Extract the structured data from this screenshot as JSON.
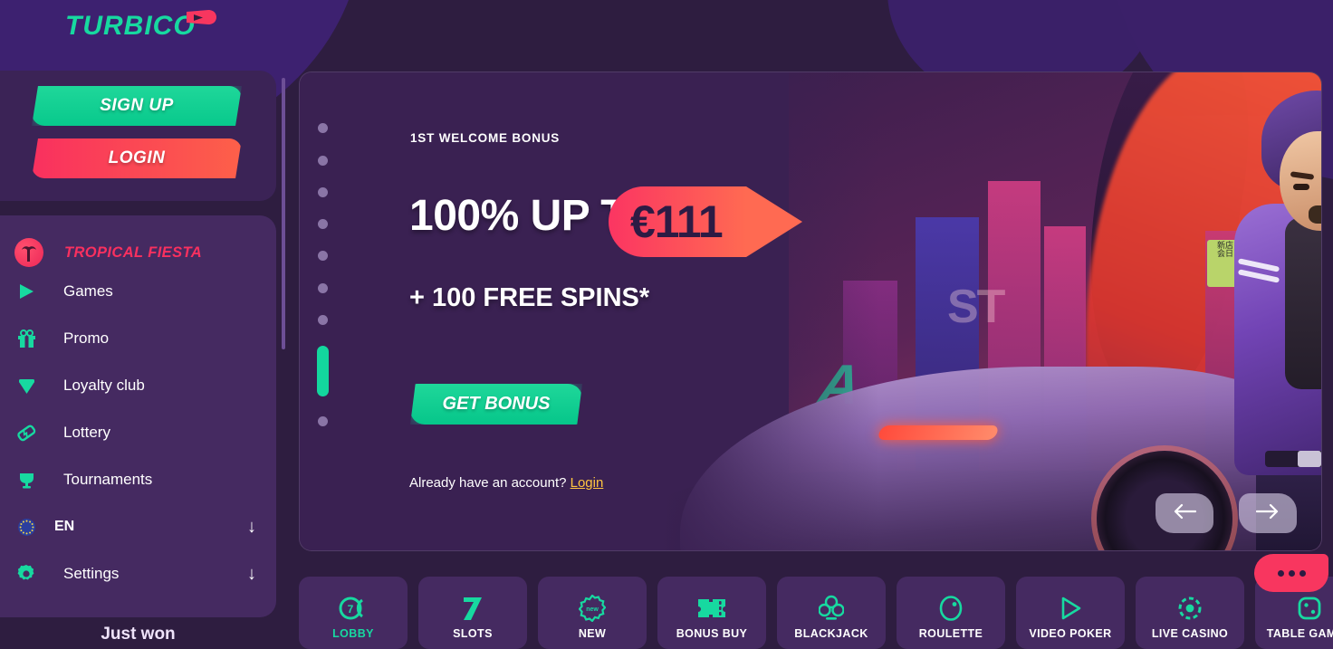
{
  "brand": {
    "name": "TURBICO",
    "logo_icon": "turbico-rocket-icon"
  },
  "auth": {
    "signup_label": "SIGN UP",
    "login_label": "LOGIN"
  },
  "sidebar": {
    "promo": {
      "label": "TROPICAL FIESTA",
      "icon": "palm-tree-circle-icon"
    },
    "items": [
      {
        "label": "Games",
        "icon": "play-triangle-icon"
      },
      {
        "label": "Promo",
        "icon": "gift-icon"
      },
      {
        "label": "Loyalty club",
        "icon": "diamond-icon"
      },
      {
        "label": "Lottery",
        "icon": "ticket-icon"
      },
      {
        "label": "Tournaments",
        "icon": "trophy-icon"
      }
    ],
    "language": {
      "label": "EN",
      "icon": "eu-flag-icon",
      "arrow": "↓"
    },
    "settings": {
      "label": "Settings",
      "icon": "gear-icon",
      "arrow": "↓"
    },
    "just_won": "Just won"
  },
  "banner": {
    "kicker": "1ST WELCOME BONUS",
    "headline": "100% UP TO",
    "amount": "€111",
    "subline": "+ 100 FREE SPINS*",
    "cta_label": "GET BONUS",
    "footer_text": "Already have an account?",
    "footer_link": "Login",
    "prev_icon": "arrow-left-icon",
    "next_icon": "arrow-right-icon",
    "slides_total": 9,
    "active_slide": 8
  },
  "chat": {
    "icon": "ellipsis-chat-icon"
  },
  "categories": [
    {
      "label": "LOBBY",
      "icon": "lobby-seven-icon",
      "active": true
    },
    {
      "label": "SLOTS",
      "icon": "seven-icon",
      "active": false
    },
    {
      "label": "NEW",
      "icon": "new-badge-icon",
      "active": false
    },
    {
      "label": "BONUS BUY",
      "icon": "bonus-ticket-icon",
      "active": false
    },
    {
      "label": "BLACKJACK",
      "icon": "club-suit-icon",
      "active": false
    },
    {
      "label": "ROULETTE",
      "icon": "roulette-wheel-icon",
      "active": false
    },
    {
      "label": "VIDEO POKER",
      "icon": "play-outline-icon",
      "active": false
    },
    {
      "label": "LIVE CASINO",
      "icon": "casino-chip-icon",
      "active": false
    },
    {
      "label": "TABLE GAMES",
      "icon": "dice-icon",
      "active": false
    }
  ],
  "colors": {
    "accent_green": "#17d9a0",
    "accent_pink": "#f8365f",
    "bg_purple": "#2e1d40",
    "card_purple": "#452a61",
    "link_gold": "#ffc640"
  }
}
